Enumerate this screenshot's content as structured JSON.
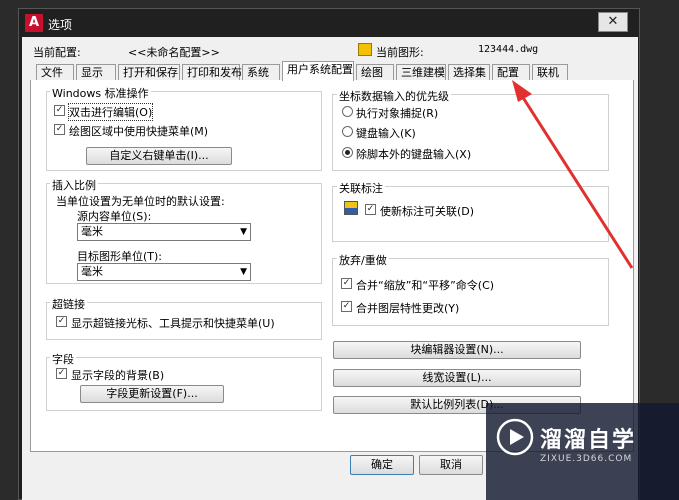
{
  "window": {
    "title": "选项",
    "logo": "A",
    "close": "✕"
  },
  "profile": {
    "label": "当前配置:",
    "value": "<<未命名配置>>",
    "drawing_label": "当前图形:",
    "drawing_value": "123444.dwg"
  },
  "tabs": [
    "文件",
    "显示",
    "打开和保存",
    "打印和发布",
    "系统",
    "用户系统配置",
    "绘图",
    "三维建模",
    "选择集",
    "配置",
    "联机"
  ],
  "active_tab": "用户系统配置",
  "windows_std": {
    "title": "Windows 标准操作",
    "dblclick": "双击进行编辑(O)",
    "shortcut_menu": "绘图区域中使用快捷菜单(M)",
    "right_click_btn": "自定义右键单击(I)..."
  },
  "insert_scale": {
    "title": "插入比例",
    "desc": "当单位设置为无单位时的默认设置:",
    "source_label": "源内容单位(S):",
    "source_value": "毫米",
    "target_label": "目标图形单位(T):",
    "target_value": "毫米"
  },
  "hyperlink": {
    "title": "超链接",
    "option": "显示超链接光标、工具提示和快捷菜单(U)"
  },
  "fields": {
    "title": "字段",
    "option": "显示字段的背景(B)",
    "btn": "字段更新设置(F)..."
  },
  "coord": {
    "title": "坐标数据输入的优先级",
    "opt1": "执行对象捕捉(R)",
    "opt2": "键盘输入(K)",
    "opt3": "除脚本外的键盘输入(X)",
    "selected": 3
  },
  "assoc": {
    "title": "关联标注",
    "option": "使新标注可关联(D)"
  },
  "undo": {
    "title": "放弃/重做",
    "opt1": "合并“缩放”和“平移”命令(C)",
    "opt2": "合并图层特性更改(Y)"
  },
  "buttons": {
    "block_editor": "块编辑器设置(N)...",
    "lineweight": "线宽设置(L)...",
    "scale_list": "默认比例列表(D)..."
  },
  "footer": {
    "ok": "确定",
    "cancel": "取消"
  },
  "watermark": {
    "name": "溜溜自学",
    "url": "ZIXUE.3D66.COM"
  },
  "annotation": {
    "arrow_color": "#e0312e"
  }
}
